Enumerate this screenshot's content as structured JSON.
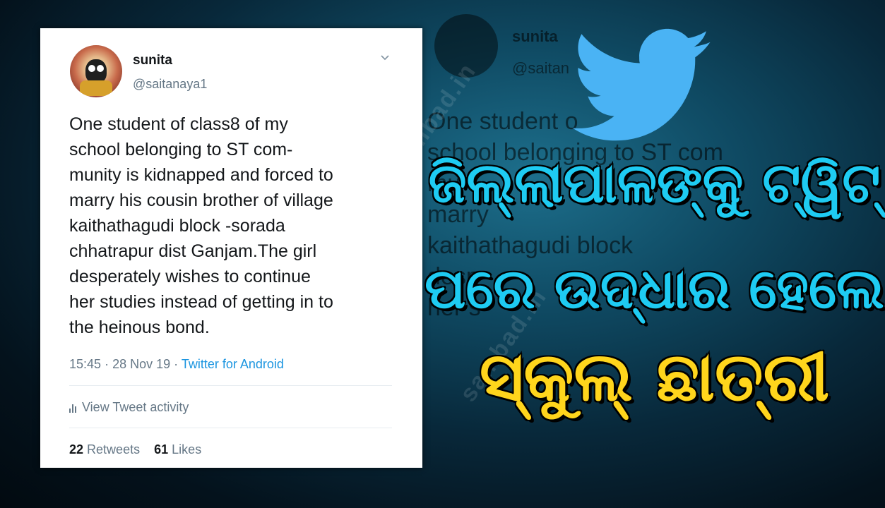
{
  "tweet": {
    "display_name": "sunita",
    "handle": "@saitanaya1",
    "text_lines": [
      "One student of  class8 of my",
      "school belonging to ST com-",
      "munity is kidnapped and forced to",
      "marry his cousin brother of village",
      "kaithathagudi block -sorada",
      "chhatrapur dist Ganjam.The girl",
      "desperately wishes to continue",
      "her studies instead of getting in to",
      "the heinous bond."
    ],
    "time": "15:45",
    "date": "28 Nov 19",
    "separator": "·",
    "source": "Twitter for Android",
    "activity_label": "View Tweet activity",
    "retweets_count": "22",
    "retweets_label": "Retweets",
    "likes_count": "61",
    "likes_label": "Likes"
  },
  "background_ghost": {
    "display_name": "sunita",
    "handle": "@saitan",
    "lines": [
      "One student o",
      "school belonging to ST com",
      "mu",
      "marry",
      "kaithathagudi block",
      "desp",
      "her s"
    ]
  },
  "watermark": "sambad.in",
  "headline": {
    "line1": "ଜିଲ୍ଲାପାଳଙ୍କୁ ଟ୍ୱିଟ୍",
    "line2": "ପରେ ଉଦ୍ଧାର ହେଲେ",
    "line3": "ସ୍କୁଲ୍ ଛାତ୍ରୀ"
  },
  "colors": {
    "headline_cyan": "#1ecbf2",
    "headline_yellow": "#ffd51c",
    "twitter_blue": "#1b95e0",
    "bird_blue": "#4ab3f4"
  },
  "icons": [
    "twitter-bird-icon",
    "chevron-down-icon",
    "bar-chart-icon"
  ]
}
